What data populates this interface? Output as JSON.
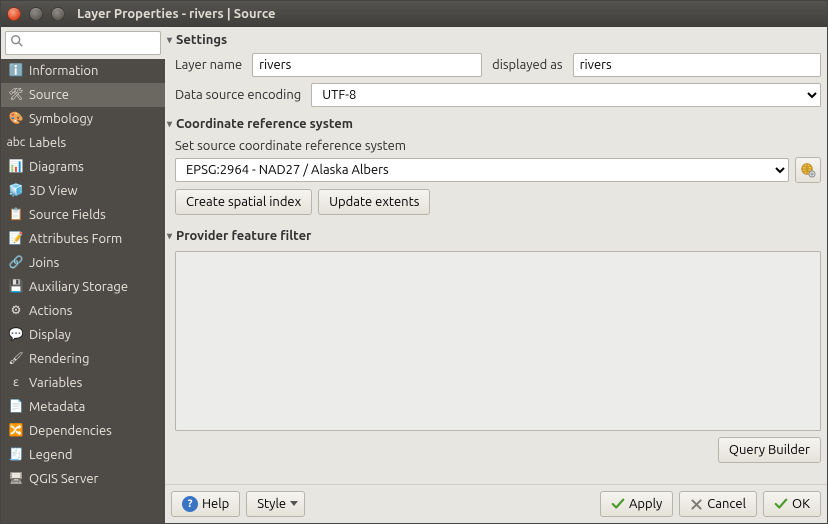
{
  "window": {
    "title": "Layer Properties - rivers | Source"
  },
  "search": {
    "placeholder": ""
  },
  "sidebar": {
    "items": [
      {
        "label": "Information",
        "icon": "ℹ️",
        "selected": false
      },
      {
        "label": "Source",
        "icon": "🛠",
        "selected": true
      },
      {
        "label": "Symbology",
        "icon": "🎨",
        "selected": false
      },
      {
        "label": "Labels",
        "icon": "abc",
        "selected": false
      },
      {
        "label": "Diagrams",
        "icon": "📊",
        "selected": false
      },
      {
        "label": "3D View",
        "icon": "🧊",
        "selected": false
      },
      {
        "label": "Source Fields",
        "icon": "📋",
        "selected": false
      },
      {
        "label": "Attributes Form",
        "icon": "📝",
        "selected": false
      },
      {
        "label": "Joins",
        "icon": "🔗",
        "selected": false
      },
      {
        "label": "Auxiliary Storage",
        "icon": "💾",
        "selected": false
      },
      {
        "label": "Actions",
        "icon": "⚙",
        "selected": false
      },
      {
        "label": "Display",
        "icon": "💬",
        "selected": false
      },
      {
        "label": "Rendering",
        "icon": "🖌",
        "selected": false
      },
      {
        "label": "Variables",
        "icon": "ε",
        "selected": false
      },
      {
        "label": "Metadata",
        "icon": "📄",
        "selected": false
      },
      {
        "label": "Dependencies",
        "icon": "🔀",
        "selected": false
      },
      {
        "label": "Legend",
        "icon": "🧾",
        "selected": false
      },
      {
        "label": "QGIS Server",
        "icon": "🖥",
        "selected": false
      }
    ]
  },
  "settings": {
    "heading": "Settings",
    "layer_name_label": "Layer name",
    "layer_name_value": "rivers",
    "displayed_as_label": "displayed as",
    "displayed_as_value": "rivers",
    "encoding_label": "Data source encoding",
    "encoding_value": "UTF-8"
  },
  "crs": {
    "heading": "Coordinate reference system",
    "set_label": "Set source coordinate reference system",
    "value": "EPSG:2964 - NAD27 / Alaska Albers",
    "create_index_label": "Create spatial index",
    "update_extents_label": "Update extents"
  },
  "filter": {
    "heading": "Provider feature filter",
    "query_builder_label": "Query Builder"
  },
  "footer": {
    "help": "Help",
    "style": "Style",
    "apply": "Apply",
    "cancel": "Cancel",
    "ok": "OK"
  }
}
